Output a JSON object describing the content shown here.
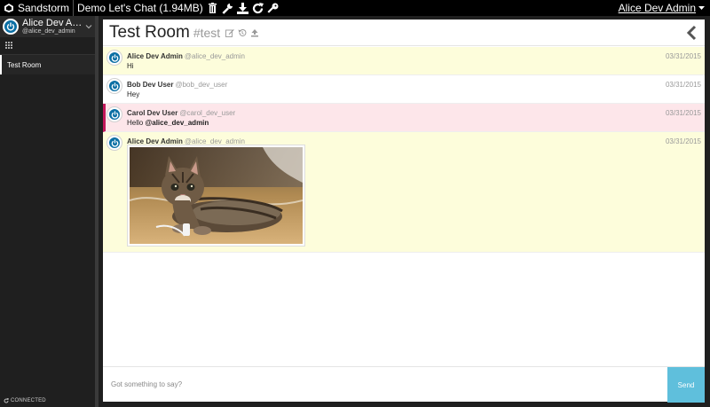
{
  "topbar": {
    "brand": "Sandstorm",
    "app_title": "Demo Let's Chat",
    "app_size": "(1.94MB)",
    "user": "Alice Dev Admin"
  },
  "sidebar": {
    "account_name": "Alice Dev Ad...",
    "account_handle": "@alice_dev_admin",
    "rooms": [
      {
        "label": "Test Room"
      }
    ],
    "status": "CONNECTED"
  },
  "room": {
    "title": "Test Room",
    "hash": "#test"
  },
  "messages": [
    {
      "user": "Alice Dev Admin",
      "handle": "@alice_dev_admin",
      "time": "03/31/2015",
      "text": "Hi"
    },
    {
      "user": "Bob Dev User",
      "handle": "@bob_dev_user",
      "time": "03/31/2015",
      "text": "Hey"
    },
    {
      "user": "Carol Dev User",
      "handle": "@carol_dev_user",
      "time": "03/31/2015",
      "text_prefix": "Hello ",
      "mention": "@alice_dev_admin"
    },
    {
      "user": "Alice Dev Admin",
      "handle": "@alice_dev_admin",
      "time": "03/31/2015"
    }
  ],
  "composer": {
    "placeholder": "Got something to say?",
    "send_label": "Send"
  },
  "colors": {
    "accent": "#5fbfdc",
    "avatar": "#0b6fa4",
    "mention_bar": "#c2185b"
  }
}
